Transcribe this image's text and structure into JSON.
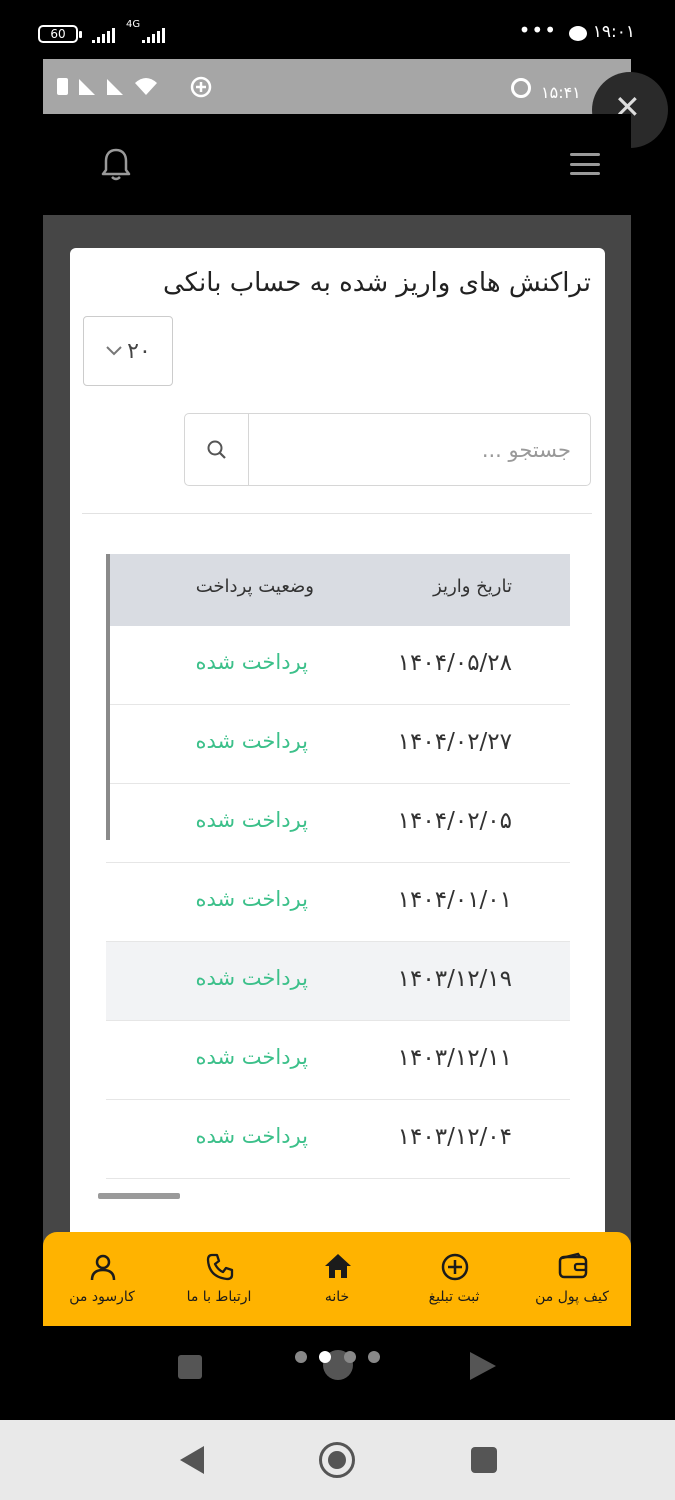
{
  "status_bar": {
    "battery": "60",
    "network": "4G",
    "time": "۱۹:۰۱",
    "dots": "•••"
  },
  "inner_status": {
    "time": "۱۵:۴۱"
  },
  "card": {
    "title": "تراکنش های واریز شده به حساب بانکی",
    "page_size": "۲۰",
    "search_placeholder": "جستجو ..."
  },
  "table": {
    "headers": {
      "date": "تاریخ واریز",
      "status": "وضعیت پرداخت"
    },
    "rows": [
      {
        "date": "۱۴۰۴/۰۵/۲۸",
        "status": "پرداخت شده"
      },
      {
        "date": "۱۴۰۴/۰۲/۲۷",
        "status": "پرداخت شده"
      },
      {
        "date": "۱۴۰۴/۰۲/۰۵",
        "status": "پرداخت شده"
      },
      {
        "date": "۱۴۰۴/۰۱/۰۱",
        "status": "پرداخت شده"
      },
      {
        "date": "۱۴۰۳/۱۲/۱۹",
        "status": "پرداخت شده"
      },
      {
        "date": "۱۴۰۳/۱۲/۱۱",
        "status": "پرداخت شده"
      },
      {
        "date": "۱۴۰۳/۱۲/۰۴",
        "status": "پرداخت شده"
      }
    ],
    "status_color": "#3cc08a"
  },
  "bottom_nav": {
    "wallet": "کیف پول من",
    "add_ad": "ثبت تبلیغ",
    "home": "خانه",
    "contact": "ارتباط با ما",
    "dashboard": "کارسود من",
    "accent": "#ffb300"
  }
}
